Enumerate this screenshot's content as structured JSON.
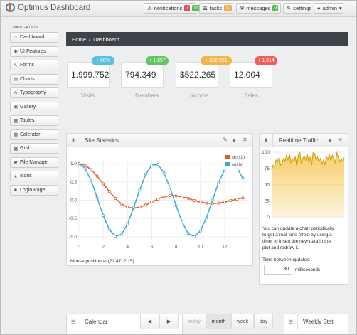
{
  "app": {
    "title": "Optimus Dashboard"
  },
  "topnav": {
    "notifications": {
      "label": "notifications",
      "badge_a": "7",
      "badge_b": "11"
    },
    "tasks": {
      "label": "tasks",
      "badge": "17"
    },
    "messages": {
      "label": "messages",
      "badge": "9"
    },
    "settings": {
      "label": "settings"
    },
    "user": {
      "label": "admin"
    }
  },
  "sidebar": {
    "heading": "NAVIGATION",
    "items": [
      {
        "label": "Dashboard",
        "icon": "home-icon"
      },
      {
        "label": "UI Features",
        "icon": "eye-icon"
      },
      {
        "label": "Forms",
        "icon": "edit-icon"
      },
      {
        "label": "Charts",
        "icon": "chart-icon"
      },
      {
        "label": "Typography",
        "icon": "font-icon"
      },
      {
        "label": "Gallery",
        "icon": "picture-icon"
      },
      {
        "label": "Tables",
        "icon": "table-icon"
      },
      {
        "label": "Calendar",
        "icon": "calendar-icon"
      },
      {
        "label": "Grid",
        "icon": "grid-icon"
      },
      {
        "label": "File Manager",
        "icon": "folder-icon"
      },
      {
        "label": "Icons",
        "icon": "star-icon"
      },
      {
        "label": "Login Page",
        "icon": "lock-icon"
      }
    ]
  },
  "breadcrumb": {
    "home": "Home",
    "sep": "/",
    "current": "Dashboard"
  },
  "stats": [
    {
      "value": "1.999.752",
      "label": "Visits",
      "delta": "+ 60%",
      "color": "#5bc0de"
    },
    {
      "value": "794.349",
      "label": "Members",
      "delta": "+ 1.657",
      "color": "#62c462"
    },
    {
      "value": "$522.265",
      "label": "Income",
      "delta": "+ $32.951",
      "color": "#f5b447"
    },
    {
      "value": "12.004",
      "label": "Sales",
      "delta": "+ 1.614",
      "color": "#ee5f5b"
    }
  ],
  "site_stats": {
    "title": "Site Statistics",
    "mouse_text": "Mouse position at (22.47, 2.15)."
  },
  "realtime": {
    "title": "Realtime Traffic",
    "desc": [
      "You can update a chart periodically",
      "to get a real-time effect by using a",
      "timer to insert the new data in the",
      "plot and redraw it."
    ],
    "interval_label": "Time between updates:",
    "interval_value": "30",
    "interval_unit": "milliseconds"
  },
  "calendar": {
    "title": "Calendar",
    "today": "today",
    "month": "month",
    "week": "week",
    "day": "day"
  },
  "weekly": {
    "title": "Weekly Stat"
  },
  "colors": {
    "sin": "#e25a2c",
    "cos": "#3aa8d6",
    "traffic_line": "#d9a20a",
    "traffic_fill": "#f6c85a"
  },
  "chart_data": [
    {
      "type": "line",
      "xlim": [
        0,
        14
      ],
      "ylim": [
        -1.1,
        1.1
      ],
      "x_ticks": [
        "0",
        "2",
        "4",
        "6",
        "8",
        "10",
        "12"
      ],
      "y_ticks": [
        "1.0",
        "0.5",
        "0.0",
        "-0.5",
        "-1.0"
      ],
      "series": [
        {
          "name": "sin(x)/x",
          "x": [
            0,
            0.5,
            1,
            1.5,
            2,
            2.5,
            3,
            3.5,
            4,
            4.5,
            5,
            5.5,
            6,
            6.5,
            7,
            7.5,
            8,
            8.5,
            9,
            9.5,
            10,
            10.5,
            11,
            11.5,
            12,
            12.5,
            13,
            13.5
          ],
          "values": [
            1.0,
            0.96,
            0.84,
            0.66,
            0.45,
            0.24,
            0.05,
            -0.1,
            -0.19,
            -0.22,
            -0.19,
            -0.13,
            -0.05,
            0.03,
            0.09,
            0.13,
            0.12,
            0.09,
            0.05,
            -0.01,
            -0.05,
            -0.08,
            -0.09,
            -0.08,
            -0.05,
            -0.01,
            0.03,
            0.06
          ]
        },
        {
          "name": "cos(x)",
          "x": [
            0,
            0.5,
            1,
            1.5,
            2,
            2.5,
            3,
            3.5,
            4,
            4.5,
            5,
            5.5,
            6,
            6.5,
            7,
            7.5,
            8,
            8.5,
            9,
            9.5,
            10,
            10.5,
            11,
            11.5,
            12,
            12.5,
            13,
            13.5
          ],
          "values": [
            1.0,
            0.88,
            0.54,
            0.07,
            -0.42,
            -0.8,
            -0.99,
            -0.94,
            -0.65,
            -0.21,
            0.28,
            0.71,
            0.96,
            0.98,
            0.75,
            0.35,
            -0.15,
            -0.6,
            -0.91,
            -1.0,
            -0.84,
            -0.48,
            0.0,
            0.48,
            0.84,
            1.0,
            0.91,
            0.6
          ]
        }
      ]
    },
    {
      "type": "area",
      "xlim": [
        0,
        100
      ],
      "ylim": [
        0,
        100
      ],
      "y_ticks": [
        "100",
        "75",
        "50",
        "25",
        "0"
      ],
      "values": [
        73,
        80,
        77,
        88,
        85,
        92,
        80,
        82,
        90,
        86,
        95,
        88,
        97,
        84,
        90,
        86,
        93,
        78,
        96,
        99,
        82,
        90,
        94,
        88,
        97,
        86,
        92,
        80,
        99,
        98,
        88,
        92,
        85,
        90,
        82,
        88,
        80,
        93,
        89,
        96,
        87,
        95,
        90,
        84,
        99,
        93,
        85,
        90,
        86,
        92
      ]
    }
  ]
}
